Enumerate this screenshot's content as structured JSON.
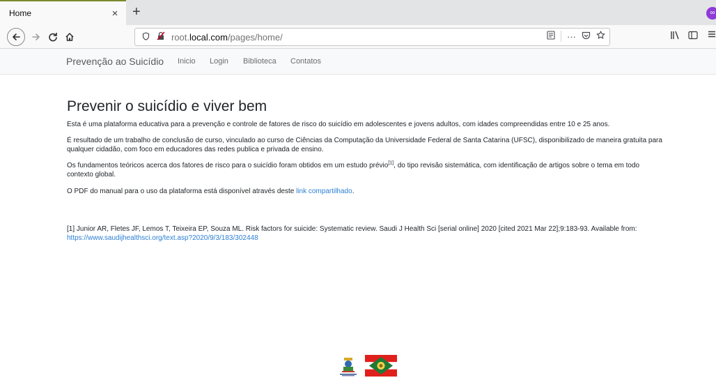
{
  "browser": {
    "tab_title": "Home",
    "tab_close": "×",
    "new_tab": "+",
    "url_prefix": "root.",
    "url_host": "local.com",
    "url_path": "/pages/home/",
    "page_actions": "···",
    "ext_badge": "∞",
    "icons": [
      "back-arrow",
      "forward-arrow",
      "reload",
      "home",
      "shield",
      "insecure-lock",
      "reader-view",
      "pocket",
      "bookmark-star",
      "library",
      "sidebar",
      "menu"
    ]
  },
  "site_nav": {
    "brand": "Prevenção ao Suicídio",
    "links": [
      "Inicio",
      "Login",
      "Biblioteca",
      "Contatos"
    ]
  },
  "main": {
    "heading": "Prevenir o suicídio e viver bem",
    "p1": "Esta é uma plataforma educativa para a prevenção e controle de fatores de risco do suicídio em adolescentes e jovens adultos, com idades compreendidas entre 10 e 25 anos.",
    "p2": "É resultado de um trabalho de conclusão de curso, vinculado ao curso de Ciências da Computação da Universidade Federal de Santa Catarina (UFSC), disponibilizado de maneira gratuita para qualquer cidadão, com foco em educadores das redes publica e privada de ensino.",
    "p3_before": "Os fundamentos teóricos acerca dos fatores de risco para o suicídio foram obtidos em um estudo prévio",
    "p3_sup": "[1]",
    "p3_after": ", do tipo revisão sistemática, com identificação de artigos sobre o tema em todo contexto global.",
    "p4_before": "O PDF do manual para o uso da plataforma está disponível através deste ",
    "p4_link": "link compartilhado",
    "p4_after": ".",
    "reference_text": "[1] Junior AR, Fletes JF, Lemos T, Teixeira EP, Souza ML. Risk factors for suicide: Systematic review. Saudi J Health Sci [serial online] 2020 [cited 2021 Mar 22];9:183-93. Available from: ",
    "reference_link": "https://www.saudijhealthsci.org/text.asp?2020/9/3/183/302448"
  },
  "colors": {
    "link": "#2a7fd4",
    "sc_flag_red": "#e0201c",
    "sc_flag_green": "#1e7a35"
  }
}
